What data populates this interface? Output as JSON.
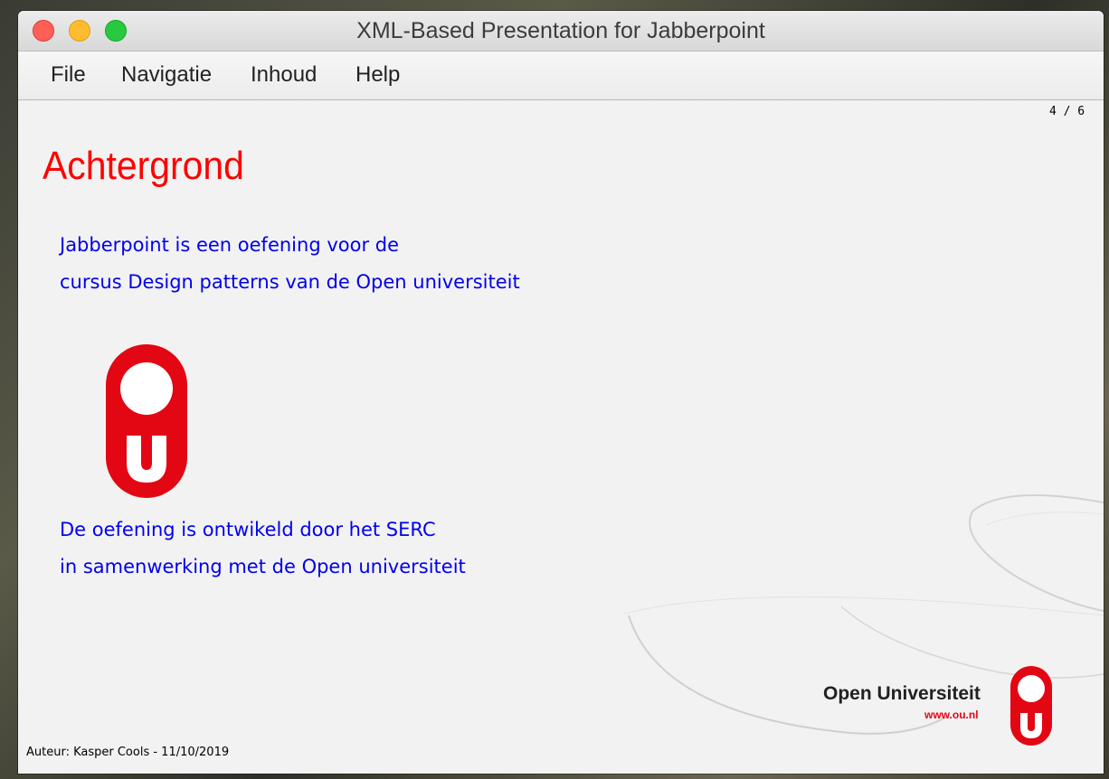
{
  "window": {
    "title": "XML-Based Presentation for Jabberpoint",
    "controls": [
      "close-button",
      "minimize-button",
      "maximize-button"
    ]
  },
  "menubar": {
    "items": [
      "File",
      "Navigatie",
      "Inhoud",
      "Help"
    ]
  },
  "slide": {
    "page_number": "4 / 6",
    "title": "Achtergrond",
    "lines": [
      "Jabberpoint is een oefening voor de",
      "cursus Design patterns van de Open universiteit",
      "De oefening is ontwikeld door het SERC",
      "in samenwerking met de Open universiteit"
    ],
    "footer": "Auteur: Kasper Cools - 11/10/2019",
    "brand": {
      "name": "Open Universiteit",
      "url": "www.ou.nl"
    }
  },
  "colors": {
    "title": "#ff0000",
    "body_text": "#0000ee",
    "logo_red": "#e30613",
    "slide_background": "#f2f2f2"
  }
}
